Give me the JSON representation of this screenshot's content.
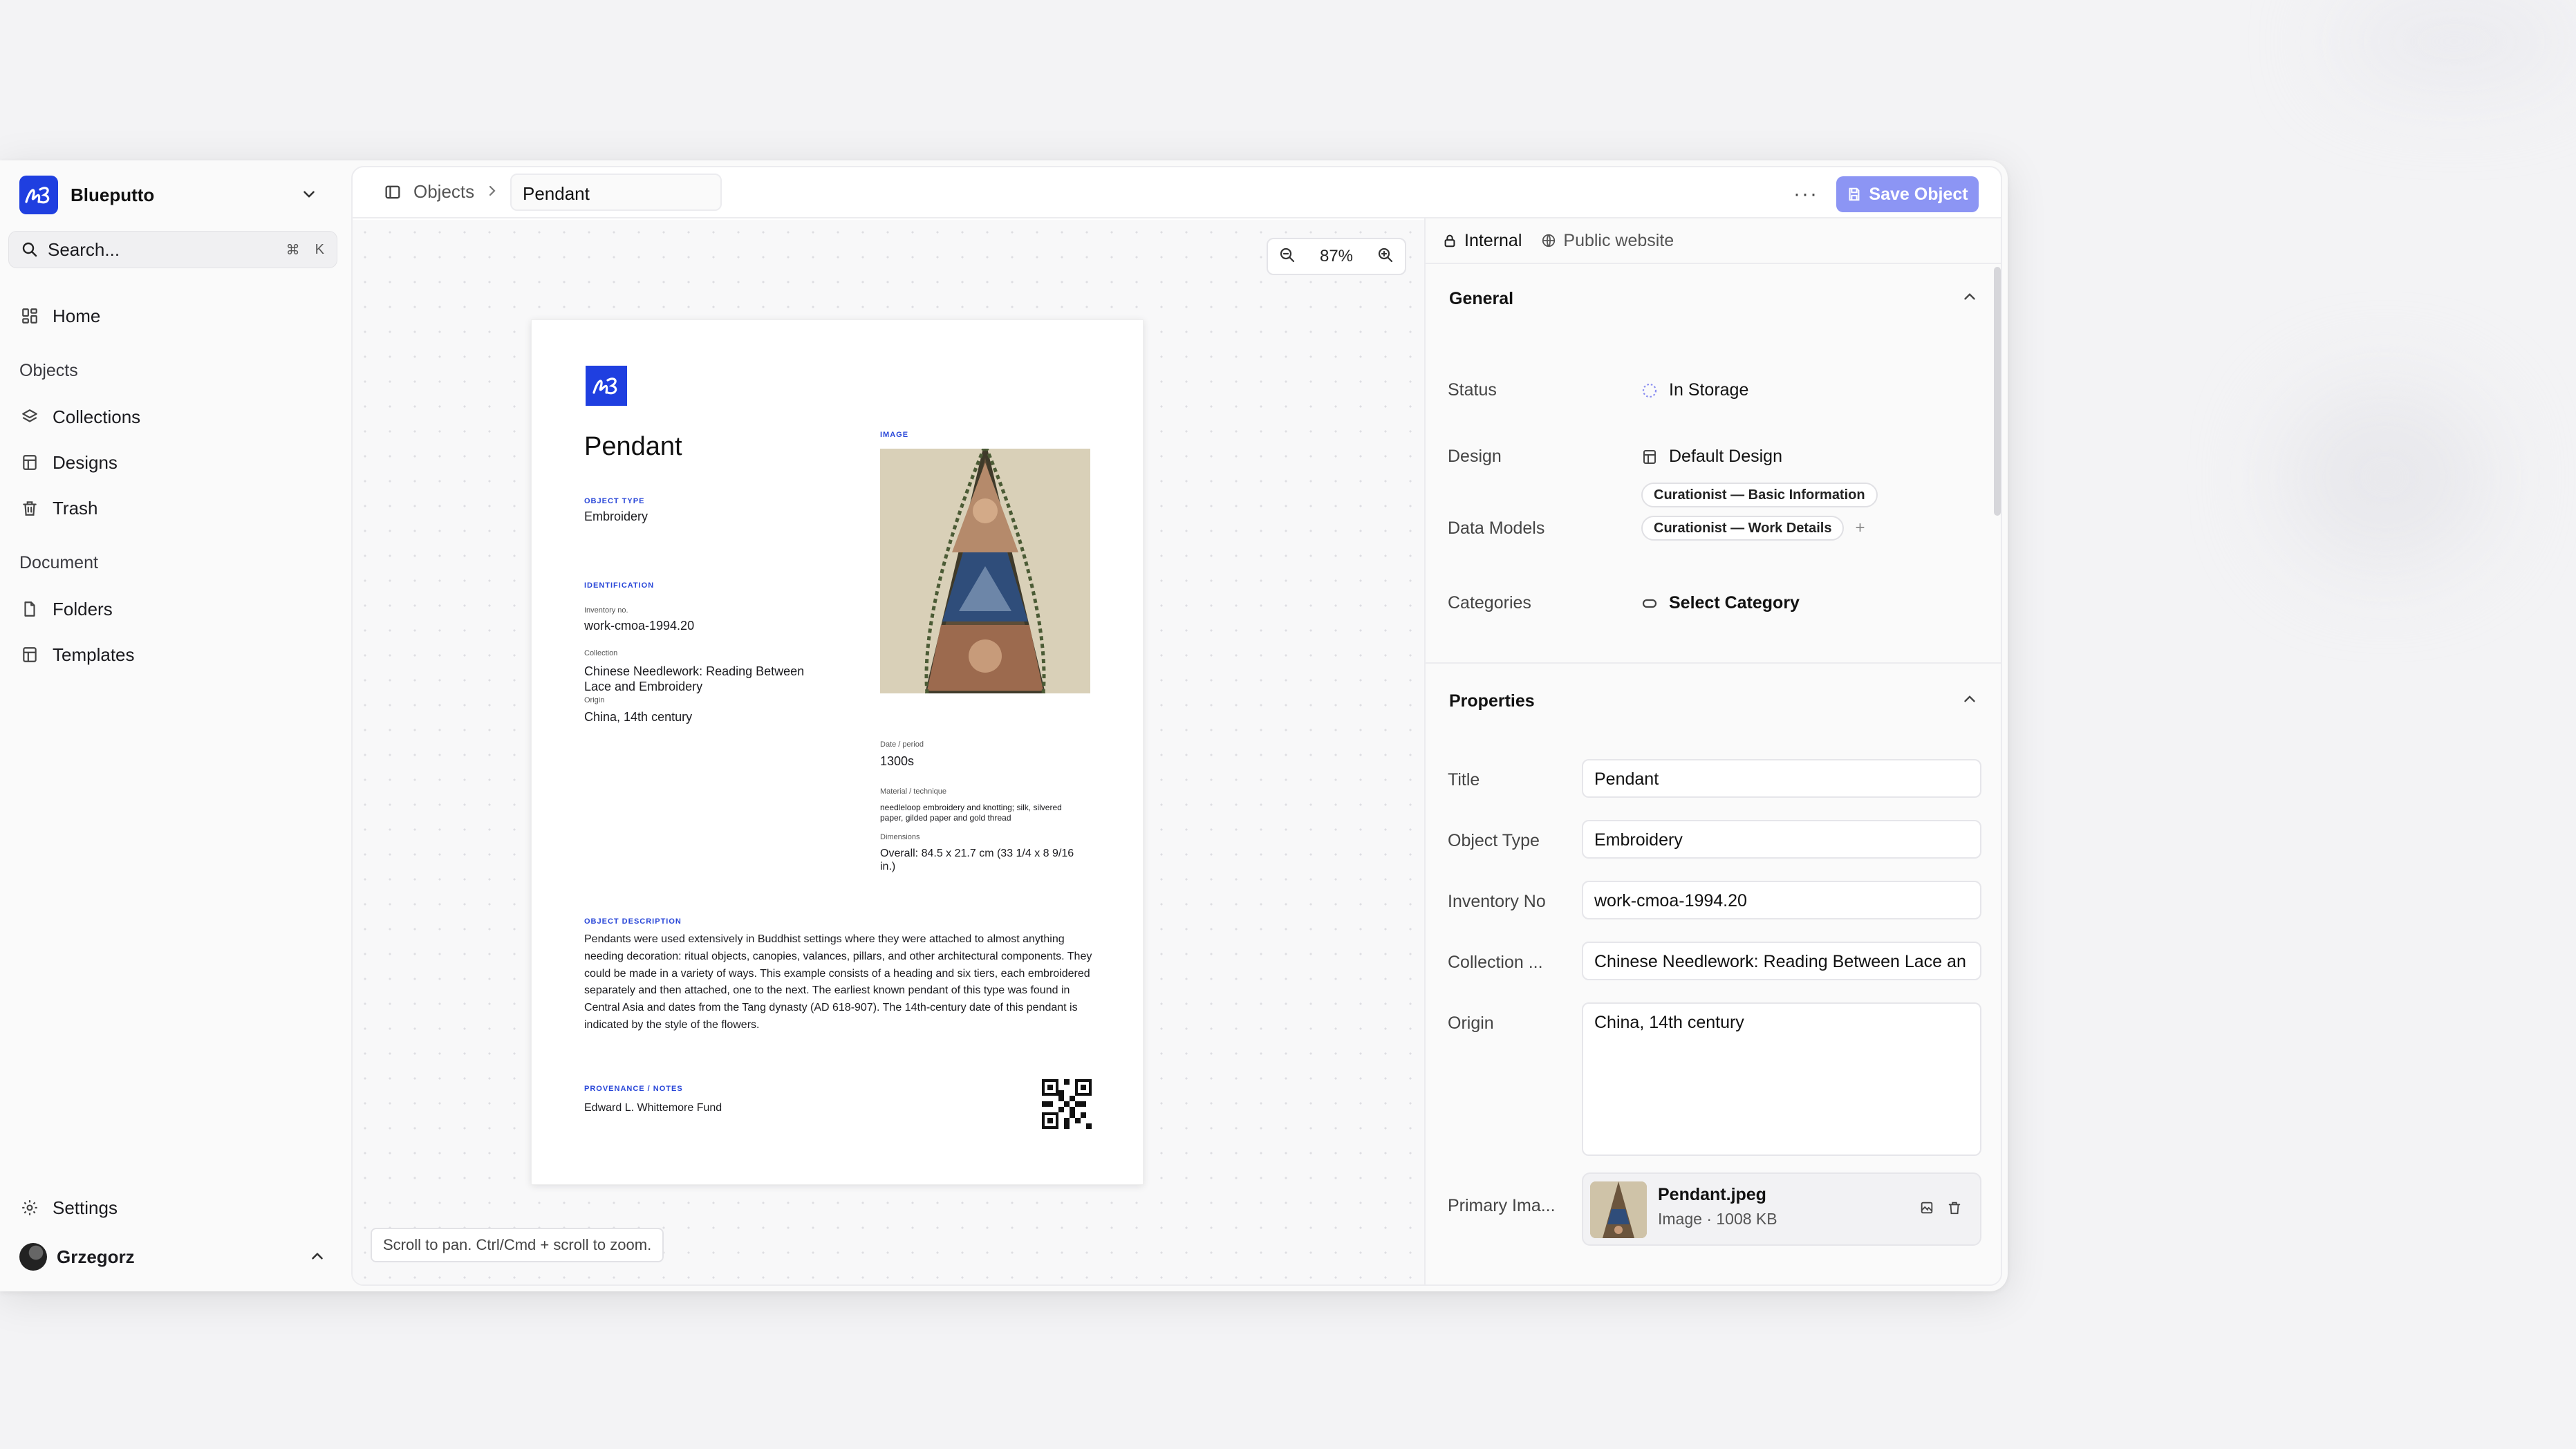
{
  "workspace": {
    "name": "Blueputto"
  },
  "search": {
    "placeholder": "Search...",
    "shortcut_mod": "⌘",
    "shortcut_key": "K"
  },
  "sidebar": {
    "home": "Home",
    "objects_section": "Objects",
    "collections": "Collections",
    "designs": "Designs",
    "trash": "Trash",
    "document_section": "Document",
    "folders": "Folders",
    "templates": "Templates",
    "settings": "Settings",
    "user": "Grzegorz"
  },
  "topbar": {
    "crumb_objects": "Objects",
    "object_name": "Pendant",
    "more": "···",
    "save_label": "Save Object"
  },
  "canvas": {
    "zoom": "87%",
    "hint": "Scroll to pan. Ctrl/Cmd + scroll to zoom."
  },
  "document": {
    "title": "Pendant",
    "object_type_kicker": "OBJECT TYPE",
    "object_type": "Embroidery",
    "identification_kicker": "IDENTIFICATION",
    "inventory_label": "Inventory no.",
    "inventory": "work-cmoa-1994.20",
    "collection_label": "Collection",
    "collection": "Chinese Needlework: Reading Between Lace and Embroidery",
    "origin_label": "Origin",
    "origin": "China, 14th century",
    "image_kicker": "IMAGE",
    "date_label": "Date / period",
    "date": "1300s",
    "material_label": "Material / technique",
    "material": "needleloop embroidery and knotting; silk, silvered paper, gilded paper and gold thread",
    "dimensions_label": "Dimensions",
    "dimensions": "Overall: 84.5 x 21.7 cm (33 1/4 x 8 9/16 in.)",
    "description_kicker": "OBJECT DESCRIPTION",
    "description": "Pendants were used extensively in Buddhist settings where they were attached to almost anything needing decoration: ritual objects, canopies, valances, pillars, and other architectural components. They could be made in a variety of ways. This example consists of a heading and six tiers, each embroidered separately and then attached, one to the next. The earliest known pendant of this type was found in Central Asia and dates from the Tang dynasty (AD 618-907). The 14th-century date of this pendant is indicated by the style of the flowers.",
    "provenance_kicker": "PROVENANCE / NOTES",
    "provenance": "Edward L. Whittemore Fund"
  },
  "panel": {
    "tab_internal": "Internal",
    "tab_public": "Public website",
    "general_title": "General",
    "status_label": "Status",
    "status_value": "In Storage",
    "design_label": "Design",
    "design_value": "Default Design",
    "data_models_label": "Data Models",
    "data_models": [
      "Curationist — Basic Information",
      "Curationist — Work Details"
    ],
    "add_model": "+",
    "categories_label": "Categories",
    "categories_value": "Select Category",
    "properties_title": "Properties",
    "title_label": "Title",
    "title_value": "Pendant",
    "object_type_label": "Object Type",
    "object_type_value": "Embroidery",
    "inventory_label": "Inventory No",
    "inventory_value": "work-cmoa-1994.20",
    "collection_label": "Collection ...",
    "collection_value": "Chinese Needlework: Reading Between Lace an",
    "origin_label": "Origin",
    "origin_value": "China, 14th century",
    "primary_image_label": "Primary Ima...",
    "file_name": "Pendant.jpeg",
    "file_meta": "Image · 1008 KB"
  },
  "colors": {
    "accent": "#1f3fe0",
    "save_button": "#8c95f4",
    "kicker": "#2846d8"
  }
}
